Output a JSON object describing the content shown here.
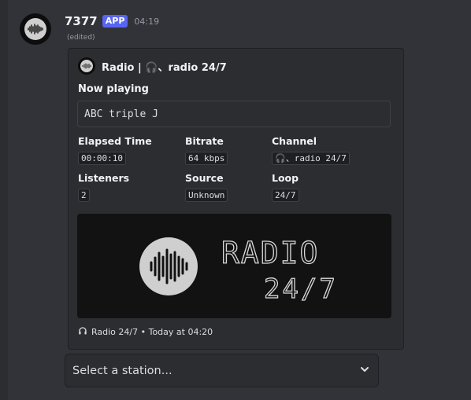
{
  "message": {
    "author": "7377",
    "badge": "APP",
    "timestamp": "04:19",
    "edited": "(edited)",
    "avatar_icon": "waveform-logo"
  },
  "embed": {
    "author_name": "Radio | 🎧、radio 24/7",
    "now_playing_label": "Now playing",
    "now_playing_value": "ABC triple J",
    "fields": {
      "elapsed": {
        "name": "Elapsed Time",
        "value": "00:00:10"
      },
      "bitrate": {
        "name": "Bitrate",
        "value": "64 kbps"
      },
      "channel": {
        "name": "Channel",
        "value": "🎧、radio 24/7"
      },
      "listeners": {
        "name": "Listeners",
        "value": "2"
      },
      "source": {
        "name": "Source",
        "value": "Unknown"
      },
      "loop": {
        "name": "Loop",
        "value": "24/7"
      }
    },
    "image_text_line1": "RADIO",
    "image_text_line2": "24/7",
    "footer_text": "Radio 24/7 • Today at 04:20",
    "footer_icon": "headphones-icon"
  },
  "station_select": {
    "placeholder": "Select a station..."
  },
  "colors": {
    "background": "#313338",
    "embed_bg": "#2b2d31",
    "badge": "#5865f2"
  }
}
